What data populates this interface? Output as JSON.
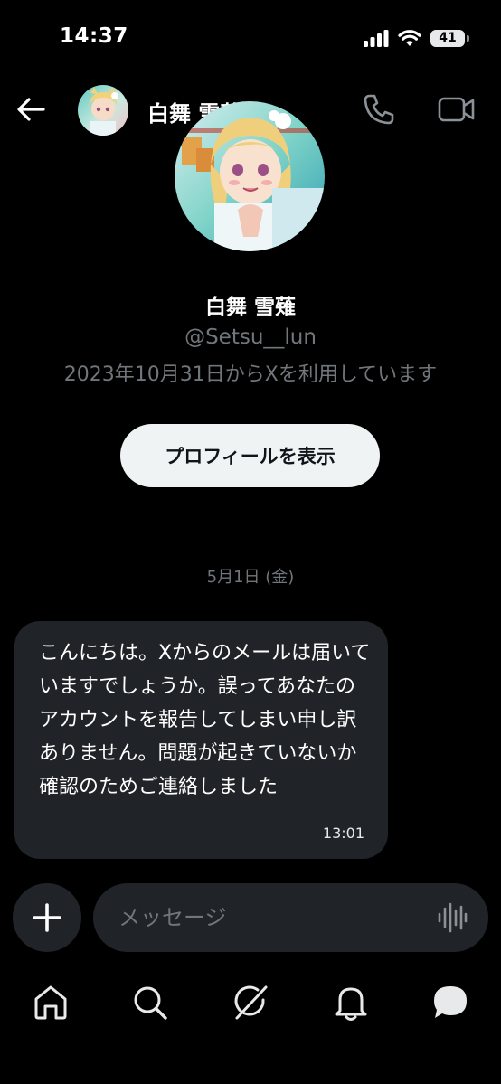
{
  "status_bar": {
    "time": "14:37",
    "battery": "41"
  },
  "header": {
    "title": "白舞 雪薙"
  },
  "profile": {
    "name": "白舞 雪薙",
    "handle": "@Setsu__lun",
    "joined": "2023年10月31日からXを利用しています",
    "view_profile_label": "プロフィールを表示"
  },
  "conversation": {
    "date_separator": "5月1日 (金)",
    "messages": [
      {
        "text": "こんにちは。Xからのメールは届いていますでしょうか。誤ってあなたのアカウントを報告してしまい申し訳ありません。問題が起きていないか確認のためご連絡しました",
        "time": "13:01"
      }
    ]
  },
  "composer": {
    "placeholder": "メッセージ"
  },
  "bottom_nav": {
    "items": [
      "home-icon",
      "search-icon",
      "grok-icon",
      "notifications-icon",
      "messages-icon"
    ]
  },
  "colors": {
    "background": "#000000",
    "bubble": "#202327",
    "secondary_text": "#71767b",
    "button_bg": "#eff3f4"
  }
}
